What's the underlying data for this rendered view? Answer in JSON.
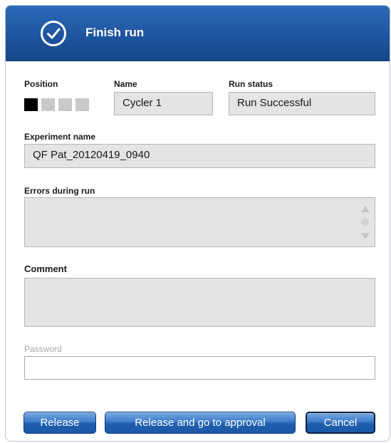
{
  "title": "Finish run",
  "title_icon": "checkmark-circle-icon",
  "colors": {
    "titlebar": "#1e559f",
    "button": "#2a68b6",
    "field_bg": "#e4e4e4"
  },
  "position": {
    "label": "Position",
    "slots": 4,
    "active_slot": 1
  },
  "name": {
    "label": "Name",
    "value": "Cycler 1"
  },
  "run_status": {
    "label": "Run status",
    "value": "Run Successful"
  },
  "experiment": {
    "label": "Experiment name",
    "value": "QF Pat_20120419_0940"
  },
  "errors": {
    "label": "Errors during run",
    "value": ""
  },
  "comment": {
    "label": "Comment",
    "value": ""
  },
  "password": {
    "label": "Password",
    "value": ""
  },
  "buttons": {
    "release": "Release",
    "release_approval": "Release and go to approval",
    "cancel": "Cancel"
  }
}
